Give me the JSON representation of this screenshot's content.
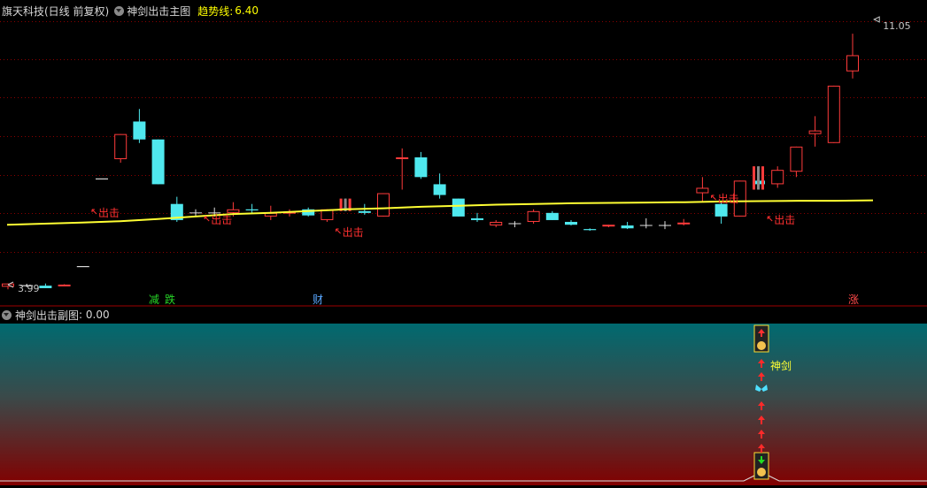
{
  "header": {
    "stock_title": "旗天科技(日线 前复权)",
    "main_indicator": "神剑出击主图",
    "trend_label": "趋势线:",
    "trend_value": "6.40"
  },
  "sub_header": {
    "indicator": "神剑出击副图",
    "value_text": ": 0.00"
  },
  "price_labels": {
    "high": "11.05",
    "low": "3.99"
  },
  "colors": {
    "up": "#ff3b3b",
    "down": "#4fe8ee",
    "trend": "#ffff33",
    "grid": "#8a0000",
    "exit_label": "#ff3030",
    "hint_green": "#27d627",
    "hint_blue": "#59a7ff",
    "hint_red": "#ff4a4a"
  },
  "chart_data": {
    "type": "candlestick",
    "ylim": [
      3.9,
      11.3
    ],
    "candles": [
      {
        "o": 3.99,
        "h": 4.06,
        "l": 3.92,
        "c": 4.08,
        "dir": "up"
      },
      {
        "o": 4.02,
        "h": 4.07,
        "l": 3.98,
        "c": 4.02,
        "dir": "flat"
      },
      {
        "o": 4.02,
        "h": 4.08,
        "l": 3.97,
        "c": 3.95,
        "dir": "down"
      },
      {
        "o": 4.02,
        "h": 4.06,
        "l": 4.01,
        "c": 4.05,
        "dir": "up"
      },
      {
        "o": 4.55,
        "h": 4.55,
        "l": 4.55,
        "c": 4.55,
        "dir": "flat"
      },
      {
        "o": 7.0,
        "h": 7.0,
        "l": 7.0,
        "c": 7.0,
        "dir": "flat"
      },
      {
        "o": 7.55,
        "h": 8.1,
        "l": 7.45,
        "c": 8.25,
        "dir": "up"
      },
      {
        "o": 8.6,
        "h": 8.95,
        "l": 8.0,
        "c": 8.1,
        "dir": "down"
      },
      {
        "o": 8.1,
        "h": 8.1,
        "l": 6.85,
        "c": 6.85,
        "dir": "down"
      },
      {
        "o": 6.3,
        "h": 6.5,
        "l": 5.8,
        "c": 5.85,
        "dir": "down"
      },
      {
        "o": 6.05,
        "h": 6.15,
        "l": 5.95,
        "c": 6.05,
        "dir": "flat"
      },
      {
        "o": 6.05,
        "h": 6.2,
        "l": 5.95,
        "c": 6.05,
        "dir": "flat"
      },
      {
        "o": 6.05,
        "h": 6.35,
        "l": 5.95,
        "c": 6.15,
        "dir": "up"
      },
      {
        "o": 6.15,
        "h": 6.3,
        "l": 6.05,
        "c": 6.12,
        "dir": "down"
      },
      {
        "o": 5.95,
        "h": 6.25,
        "l": 5.85,
        "c": 6.05,
        "dir": "up"
      },
      {
        "o": 6.05,
        "h": 6.15,
        "l": 5.95,
        "c": 6.08,
        "dir": "up"
      },
      {
        "o": 6.15,
        "h": 6.2,
        "l": 5.95,
        "c": 5.98,
        "dir": "down"
      },
      {
        "o": 5.85,
        "h": 6.15,
        "l": 5.8,
        "c": 6.15,
        "dir": "up"
      },
      {
        "o": 6.15,
        "h": 6.45,
        "l": 6.1,
        "c": 6.18,
        "dir": "down"
      },
      {
        "o": 6.1,
        "h": 6.3,
        "l": 6.0,
        "c": 6.05,
        "dir": "down"
      },
      {
        "o": 5.95,
        "h": 6.3,
        "l": 5.95,
        "c": 6.6,
        "dir": "up"
      },
      {
        "o": 7.6,
        "h": 7.85,
        "l": 6.7,
        "c": 7.6,
        "dir": "up"
      },
      {
        "o": 7.6,
        "h": 7.75,
        "l": 7.0,
        "c": 7.05,
        "dir": "down"
      },
      {
        "o": 6.85,
        "h": 7.15,
        "l": 6.45,
        "c": 6.55,
        "dir": "down"
      },
      {
        "o": 6.45,
        "h": 6.45,
        "l": 5.95,
        "c": 5.95,
        "dir": "down"
      },
      {
        "o": 5.9,
        "h": 6.05,
        "l": 5.8,
        "c": 5.85,
        "dir": "down"
      },
      {
        "o": 5.7,
        "h": 5.85,
        "l": 5.65,
        "c": 5.8,
        "dir": "up"
      },
      {
        "o": 5.75,
        "h": 5.82,
        "l": 5.65,
        "c": 5.75,
        "dir": "flat"
      },
      {
        "o": 5.8,
        "h": 6.15,
        "l": 5.75,
        "c": 6.1,
        "dir": "up"
      },
      {
        "o": 6.05,
        "h": 6.1,
        "l": 5.85,
        "c": 5.85,
        "dir": "down"
      },
      {
        "o": 5.8,
        "h": 5.85,
        "l": 5.7,
        "c": 5.72,
        "dir": "down"
      },
      {
        "o": 5.6,
        "h": 5.62,
        "l": 5.55,
        "c": 5.57,
        "dir": "down"
      },
      {
        "o": 5.68,
        "h": 5.72,
        "l": 5.65,
        "c": 5.72,
        "dir": "up"
      },
      {
        "o": 5.7,
        "h": 5.8,
        "l": 5.6,
        "c": 5.62,
        "dir": "down"
      },
      {
        "o": 5.7,
        "h": 5.9,
        "l": 5.62,
        "c": 5.7,
        "dir": "flat"
      },
      {
        "o": 5.7,
        "h": 5.82,
        "l": 5.6,
        "c": 5.7,
        "dir": "flat"
      },
      {
        "o": 5.75,
        "h": 5.88,
        "l": 5.7,
        "c": 5.78,
        "dir": "up"
      },
      {
        "o": 6.6,
        "h": 7.05,
        "l": 6.35,
        "c": 6.75,
        "dir": "up"
      },
      {
        "o": 6.3,
        "h": 6.35,
        "l": 5.75,
        "c": 5.95,
        "dir": "down"
      },
      {
        "o": 5.95,
        "h": 6.95,
        "l": 5.95,
        "c": 6.95,
        "dir": "up"
      },
      {
        "o": 6.95,
        "h": 7.35,
        "l": 6.7,
        "c": 6.85,
        "dir": "down"
      },
      {
        "o": 6.85,
        "h": 7.35,
        "l": 6.75,
        "c": 7.25,
        "dir": "up"
      },
      {
        "o": 7.2,
        "h": 7.9,
        "l": 7.05,
        "c": 7.9,
        "dir": "up"
      },
      {
        "o": 8.25,
        "h": 8.75,
        "l": 7.9,
        "c": 8.35,
        "dir": "up"
      },
      {
        "o": 8.0,
        "h": 9.6,
        "l": 8.0,
        "c": 9.6,
        "dir": "up"
      },
      {
        "o": 10.0,
        "h": 11.05,
        "l": 9.8,
        "c": 10.45,
        "dir": "up"
      }
    ],
    "trend_line": [
      5.72,
      5.75,
      5.78,
      5.82,
      5.88,
      5.95,
      6.02,
      6.05,
      6.1,
      6.15,
      6.18,
      6.22,
      6.25,
      6.28,
      6.3,
      6.32,
      6.33,
      6.34,
      6.35,
      6.37,
      6.38,
      6.39,
      6.39,
      6.4
    ]
  },
  "annotations": {
    "exit_signal_text": "出击",
    "sub_signal_text": "神剑",
    "hints": {
      "reduce": "减",
      "fall": "跌",
      "wealth": "财",
      "rise": "涨"
    }
  }
}
